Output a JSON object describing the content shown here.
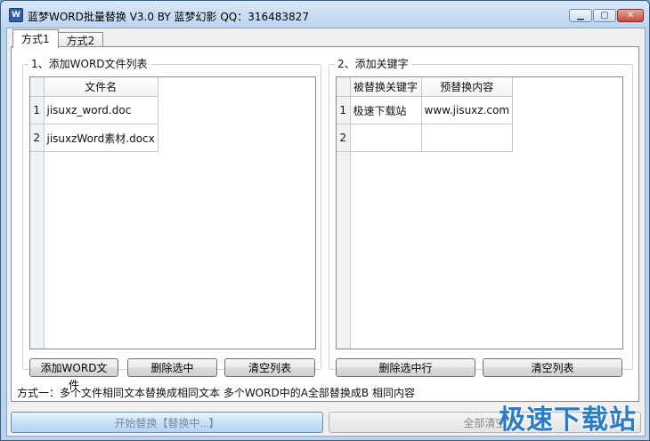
{
  "window": {
    "title": "蓝梦WORD批量替换 V3.0 BY 蓝梦幻影 QQ：316483827",
    "icon": "word-app-icon",
    "controls": [
      "minimize-icon",
      "maximize-icon",
      "close-icon"
    ]
  },
  "tabs": [
    {
      "label": "方式1",
      "active": true
    },
    {
      "label": "方式2",
      "active": false
    }
  ],
  "left_group": {
    "title": "1、添加WORD文件列表",
    "column_header": "文件名",
    "rows": [
      {
        "num": "1",
        "name": "jisuxz_word.doc"
      },
      {
        "num": "2",
        "name": "jisuxzWord素材.docx"
      }
    ],
    "buttons": {
      "add": "添加WORD文件",
      "delete": "删除选中",
      "clear": "清空列表"
    }
  },
  "right_group": {
    "title": "2、添加关键字",
    "headers": [
      "被替换关键字",
      "预替换内容"
    ],
    "rows": [
      {
        "num": "1",
        "keyword": "极速下载站",
        "replace": "www.jisuxz.com"
      },
      {
        "num": "2",
        "keyword": "",
        "replace": ""
      }
    ],
    "buttons": {
      "delete": "删除选中行",
      "clear": "清空列表"
    }
  },
  "status_line": "方式一：多个文件相同文本替换成相同文本   多个WORD中的A全部替换成B 相同内容",
  "bottom": {
    "start": "开始替换【替换中...】",
    "clear_all": "全部清空"
  },
  "watermark": "极速下载站",
  "colors": {
    "title_gradient_top": "#d8e8f8",
    "start_button": "#c8e1f8",
    "watermark": "#2a7cc7",
    "close_button": "#c9473a"
  }
}
